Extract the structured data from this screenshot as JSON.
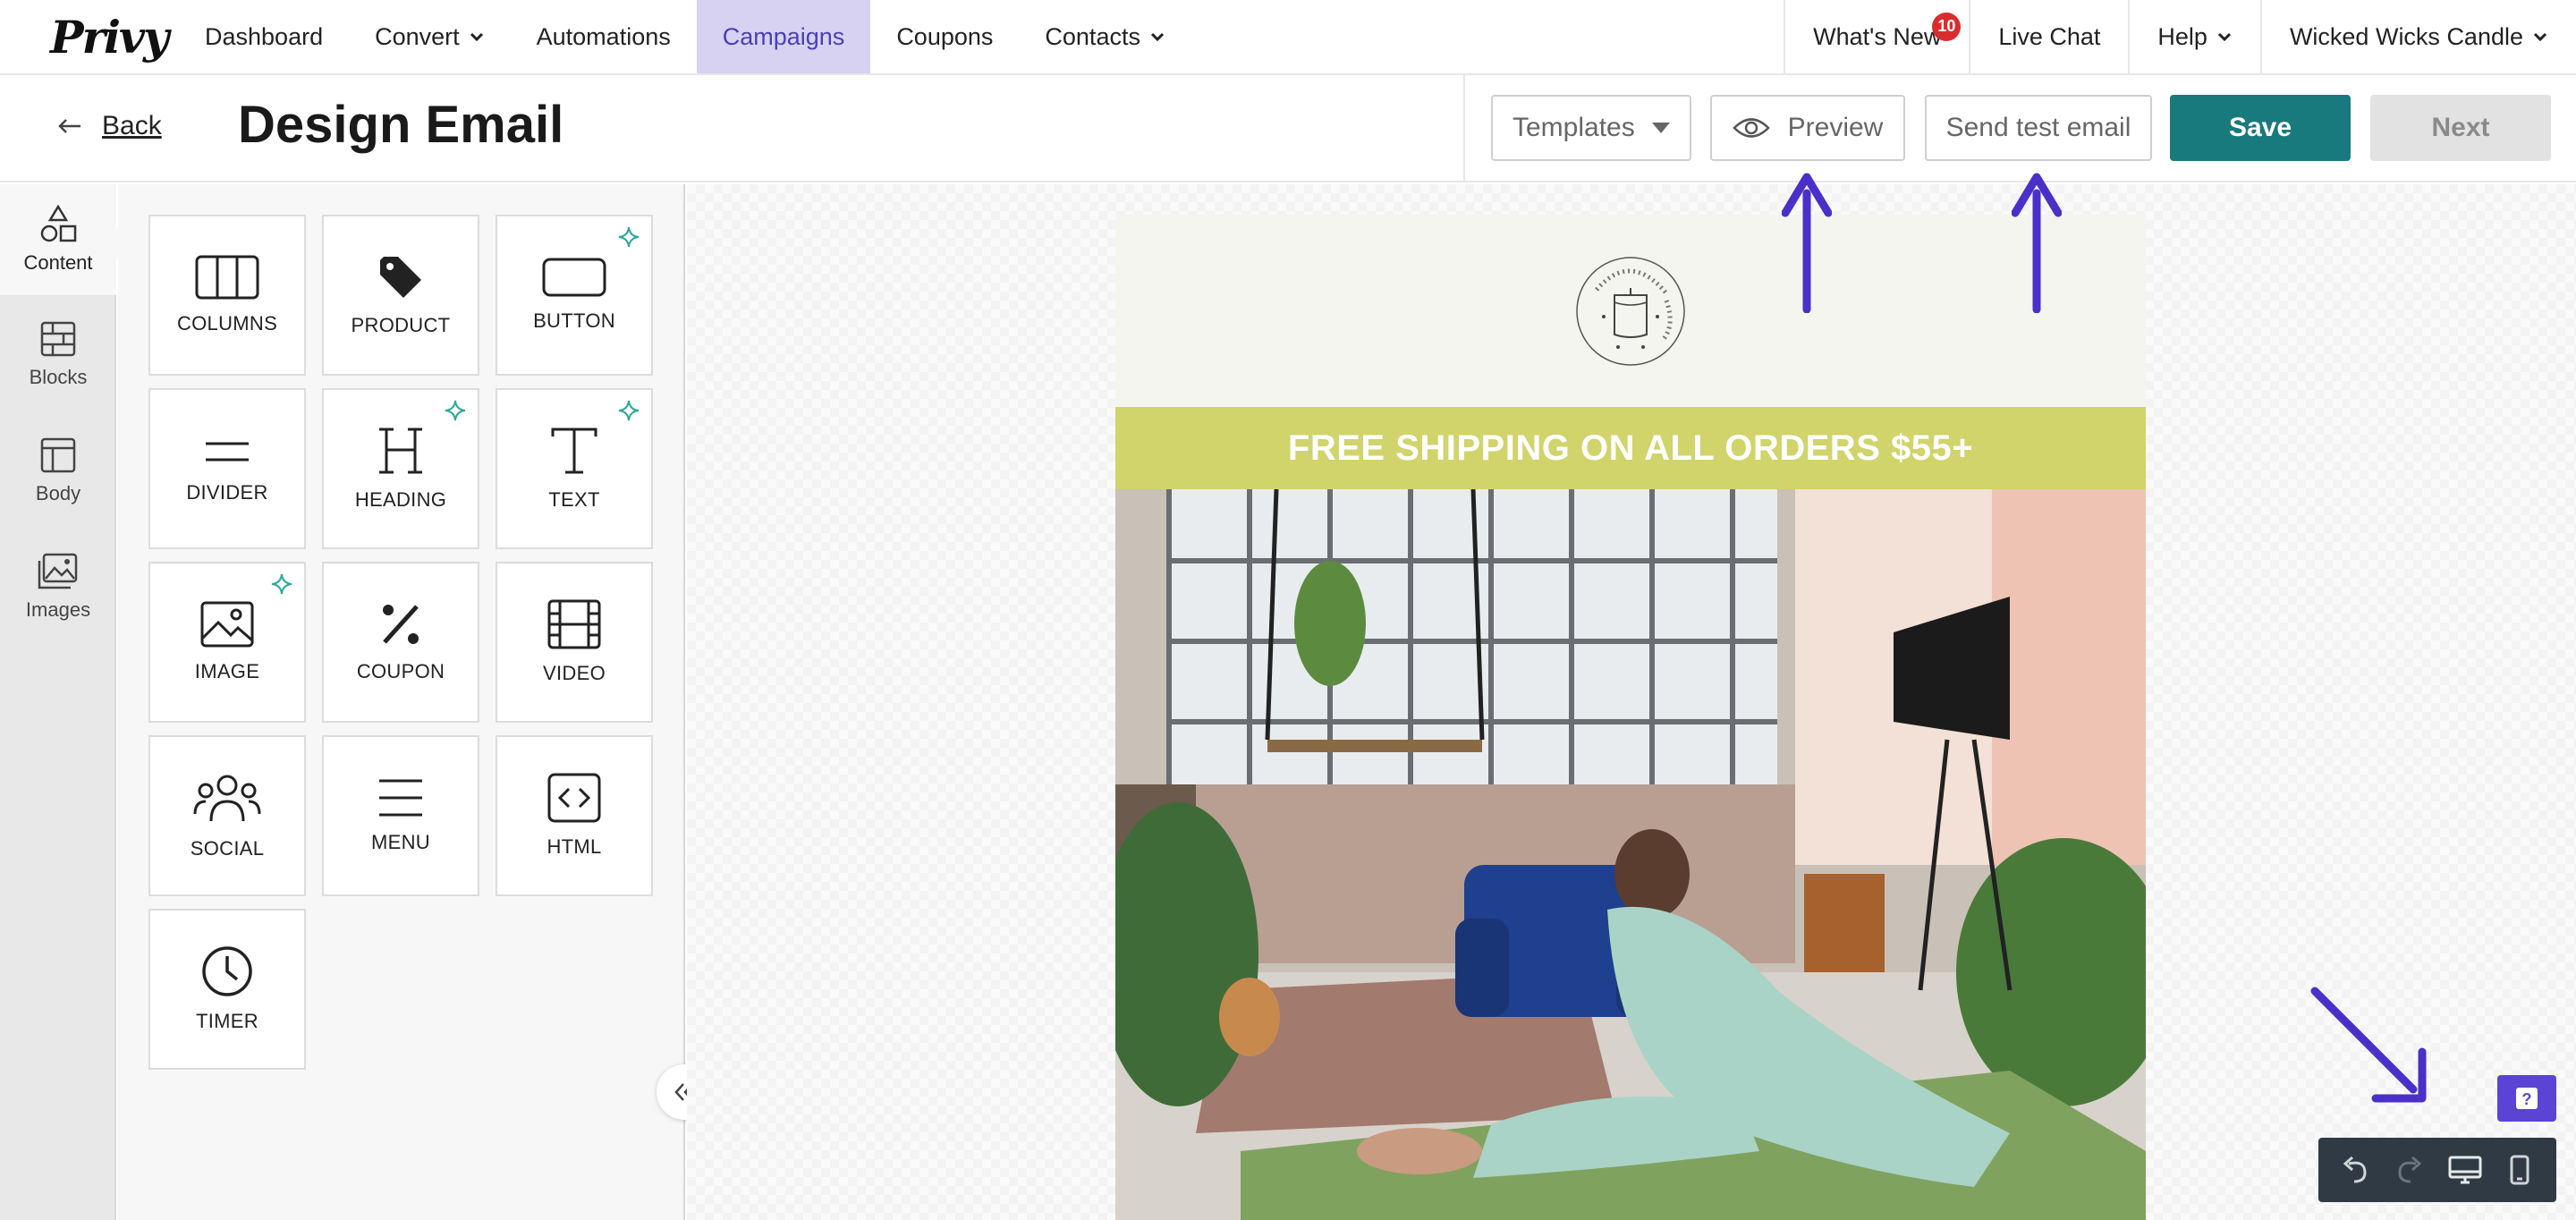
{
  "nav": {
    "logo": "Privy",
    "items": [
      {
        "label": "Dashboard",
        "dropdown": false,
        "active": false
      },
      {
        "label": "Convert",
        "dropdown": true,
        "active": false
      },
      {
        "label": "Automations",
        "dropdown": false,
        "active": false
      },
      {
        "label": "Campaigns",
        "dropdown": false,
        "active": true
      },
      {
        "label": "Coupons",
        "dropdown": false,
        "active": false
      },
      {
        "label": "Contacts",
        "dropdown": true,
        "active": false
      }
    ],
    "whats_new": "What's New",
    "whats_new_badge": "10",
    "live_chat": "Live Chat",
    "help": "Help",
    "account": "Wicked Wicks Candle",
    "active_color": "#d7d2f2"
  },
  "header": {
    "back": "Back",
    "title": "Design Email",
    "templates": "Templates",
    "preview": "Preview",
    "send_test": "Send test email",
    "save": "Save",
    "next": "Next",
    "save_color": "#197a7d"
  },
  "rail": {
    "items": [
      {
        "label": "Content",
        "icon": "shapes-icon",
        "active": true
      },
      {
        "label": "Blocks",
        "icon": "blocks-icon",
        "active": false
      },
      {
        "label": "Body",
        "icon": "body-layout-icon",
        "active": false
      },
      {
        "label": "Images",
        "icon": "images-icon",
        "active": false
      }
    ]
  },
  "content_tiles": [
    {
      "label": "COLUMNS",
      "icon": "columns-icon",
      "ai": false
    },
    {
      "label": "PRODUCT",
      "icon": "tag-icon",
      "ai": false
    },
    {
      "label": "BUTTON",
      "icon": "button-icon",
      "ai": true
    },
    {
      "label": "DIVIDER",
      "icon": "divider-icon",
      "ai": false
    },
    {
      "label": "HEADING",
      "icon": "heading-icon",
      "ai": true
    },
    {
      "label": "TEXT",
      "icon": "text-icon",
      "ai": true
    },
    {
      "label": "IMAGE",
      "icon": "image-icon",
      "ai": true
    },
    {
      "label": "COUPON",
      "icon": "percent-icon",
      "ai": false
    },
    {
      "label": "VIDEO",
      "icon": "film-icon",
      "ai": false
    },
    {
      "label": "SOCIAL",
      "icon": "people-icon",
      "ai": false
    },
    {
      "label": "MENU",
      "icon": "menu-icon",
      "ai": false
    },
    {
      "label": "HTML",
      "icon": "code-icon",
      "ai": false
    },
    {
      "label": "TIMER",
      "icon": "clock-icon",
      "ai": false
    }
  ],
  "email": {
    "logo_text": "WICKED WICKS CANDLE CO.",
    "shipping_banner": "FREE SHIPPING ON ALL ORDERS $55+",
    "banner_color": "#d0d46a",
    "header_bg": "#f5f5ef"
  },
  "annotations": {
    "arrow_color": "#4b2fc9"
  }
}
